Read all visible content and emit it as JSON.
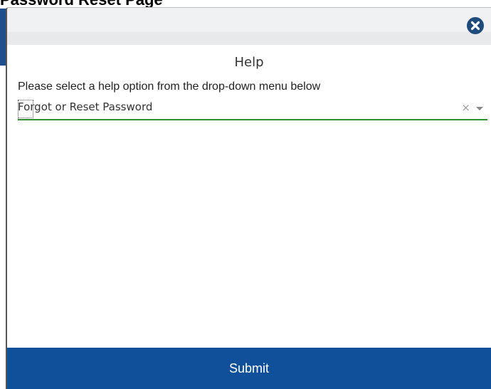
{
  "page": {
    "title": "Password Reset Page"
  },
  "modal": {
    "close_icon": "close-circle-icon",
    "help_title": "Help",
    "instruction": "Please select a help option from the drop-down menu below",
    "help_select": {
      "selected_value": "Forgot or Reset Password",
      "clear_glyph": "×"
    },
    "submit_label": "Submit"
  },
  "colors": {
    "accent": "#10509a",
    "close_button": "#1f4a7c",
    "select_underline": "#2e8b2e",
    "header_bg": "#f0f1f3"
  }
}
